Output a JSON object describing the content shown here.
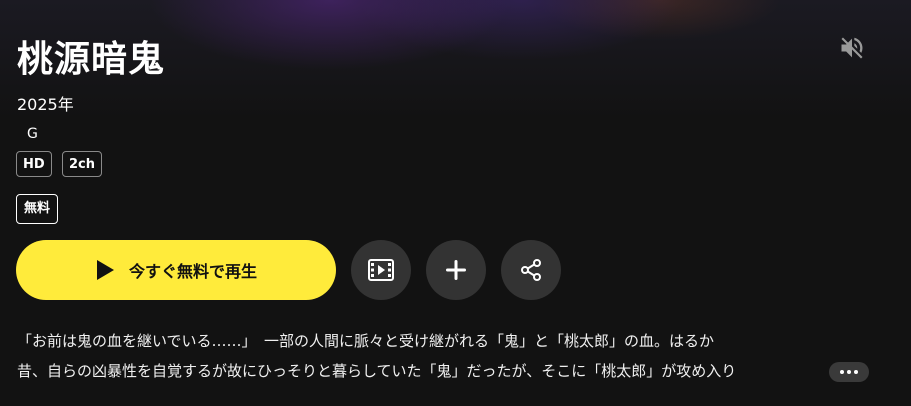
{
  "title": "桃源暗鬼",
  "year": "2025年",
  "rating": "G",
  "badges": [
    "HD",
    "2ch"
  ],
  "price_badge": "無料",
  "actions": {
    "play_label": "今すぐ無料で再生",
    "trailer_icon": "video-clip-icon",
    "add_icon": "plus-icon",
    "share_icon": "share-icon"
  },
  "mute_icon": "speaker-muted-icon",
  "description": {
    "line1": "「お前は鬼の血を継いでいる……」　一部の人間に脈々と受け継がれる「鬼」と「桃太郎」の血。はるか",
    "line2": "昔、自らの凶暴性を自覚するが故にひっそりと暮らしていた「鬼」だったが、そこに「桃太郎」が攻め入り"
  },
  "colors": {
    "background": "#121212",
    "accent": "#ffeb3b",
    "button_dark": "#333333"
  }
}
